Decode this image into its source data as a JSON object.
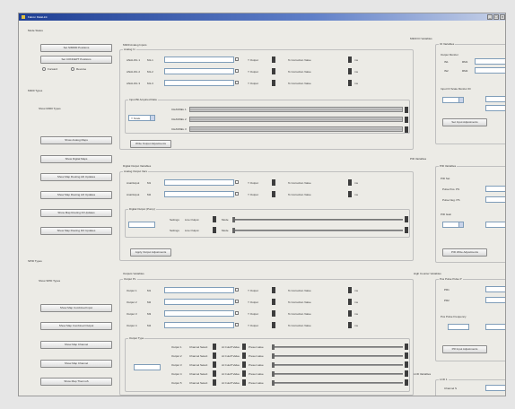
{
  "window": {
    "title": "Falcon DataLink"
  },
  "left": {
    "mode_section": {
      "title": "Mode Status",
      "buttons": [
        "Set SIM600 Positions",
        "Set CONCEPT Positions"
      ],
      "radios": [
        "Forward",
        "Reverse"
      ]
    },
    "io_section": {
      "title": "M300 Types",
      "subtitle": "Show M300 Types",
      "buttons": [
        "Show Analog Maps",
        "Show Digital Maps",
        "Show Map Routing AD Updates",
        "Show Map Routing AO Updates",
        "Show Map Routing DI Updates",
        "Show Map Routing DO Updates"
      ]
    },
    "tpd_section": {
      "title": "SPID Types",
      "subtitle": "Show SPID Types",
      "buttons": [
        "Show Map Combined Input",
        "Show Map Combined Output",
        "Show Map Channel",
        "Show Map Channel",
        "Show Map ThermoS"
      ]
    }
  },
  "analog_inputs": {
    "title": "M300 Analog Inputs",
    "subtitle": "Analog In",
    "rows": [
      {
        "name": "ANALOG 1",
        "ch": "M1-1"
      },
      {
        "name": "ANALOG 2",
        "ch": "M1-2"
      },
      {
        "name": "ANALOG 3",
        "ch": "M1-3"
      }
    ],
    "col_a": "Y Output",
    "col_b": "% Correction Value",
    "col_c": "ms",
    "sub_title": "Input Bit Acquired Data",
    "level": "Y Scale",
    "channels": [
      "CHANNEL 1",
      "CHANNEL 2",
      "CHANNEL 3"
    ],
    "apply_button": "Write Output Adjustments"
  },
  "dig_outputs": {
    "title": "Digital Output Variables",
    "subtitle": "Analog Output Vars",
    "rows": [
      {
        "name": "AnaOutput",
        "ch": "M1"
      },
      {
        "name": "AnaOutput",
        "ch": "M2"
      }
    ],
    "col_a": "Y Output",
    "col_b": "% Correction Value",
    "col_c": "ms",
    "pulse_title": "Digital Output (Pump)",
    "settings": "Settings",
    "line_output": "Line Output",
    "mode": "Mode",
    "apply_button": "Apply Output Adjustments"
  },
  "outputs": {
    "title": "Outputs Variables",
    "subtitle": "Output PL",
    "rows": [
      "Output 1",
      "Output 2",
      "Output 3",
      "Output 4"
    ],
    "ch_labels": [
      "M1",
      "M2",
      "M3",
      "M4"
    ],
    "col_a": "Y Output",
    "col_b": "% Correction Value",
    "col_c": "ms",
    "output_cfg": "Output Type",
    "cfg_rows": [
      "Output 1",
      "Output 2",
      "Output 3",
      "Output 4",
      "Output 5"
    ],
    "cfg_a": "Channel Select",
    "cfg_b": "At Cutoff Value",
    "cfg_c": "Preset value"
  },
  "right": {
    "status_title": "M300 IO Variables",
    "status_sub": "IO Variables",
    "status_rows": [
      "Output Monitor",
      "IN1",
      "IN2"
    ],
    "scale_label": "Input IO Scale Monitor ID",
    "values": [
      "RM1",
      "RM2"
    ],
    "status_button": "Set Input Adjustments",
    "pid_title": "PID Variables",
    "pid_sub": "PID Variables",
    "pid_rows": [
      "PID Set",
      "Pulse Pos. PS",
      "Pulse Neg. PS",
      "PID Gain"
    ],
    "pid_button": "PID Write Adjustments",
    "hsc_title": "High Counter Variables",
    "hsc_sub": "Pos Pulse Pulse P",
    "hsc_rows": [
      "PR1",
      "PR2"
    ],
    "hsc_label": "Pos Pulse Frequency",
    "hsc_button": "PR Input Adjustments",
    "lcd_title": "LCD Variables",
    "lcd_sub": "LCD 1",
    "lcd_rows": [
      "Channel S"
    ]
  }
}
